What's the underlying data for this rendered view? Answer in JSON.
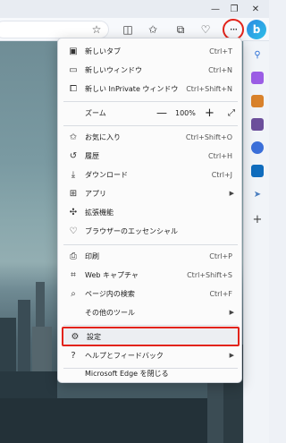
{
  "toolbar": {
    "more_label": "···",
    "copilot_label": "b"
  },
  "menu": {
    "new_tab": {
      "label": "新しいタブ",
      "shortcut": "Ctrl+T"
    },
    "new_window": {
      "label": "新しいウィンドウ",
      "shortcut": "Ctrl+N"
    },
    "new_inprivate": {
      "label": "新しい InPrivate ウィンドウ",
      "shortcut": "Ctrl+Shift+N"
    },
    "zoom": {
      "label": "ズーム",
      "minus": "—",
      "value": "100%",
      "plus": "+"
    },
    "favorites": {
      "label": "お気に入り",
      "shortcut": "Ctrl+Shift+O"
    },
    "history": {
      "label": "履歴",
      "shortcut": "Ctrl+H"
    },
    "downloads": {
      "label": "ダウンロード",
      "shortcut": "Ctrl+J"
    },
    "apps": {
      "label": "アプリ"
    },
    "extensions": {
      "label": "拡張機能"
    },
    "browser_essentials": {
      "label": "ブラウザーのエッセンシャル"
    },
    "print": {
      "label": "印刷",
      "shortcut": "Ctrl+P"
    },
    "web_capture": {
      "label": "Web キャプチャ",
      "shortcut": "Ctrl+Shift+S"
    },
    "find_on_page": {
      "label": "ページ内の検索",
      "shortcut": "Ctrl+F"
    },
    "more_tools": {
      "label": "その他のツール"
    },
    "settings": {
      "label": "設定"
    },
    "help_feedback": {
      "label": "ヘルプとフィードバック"
    },
    "close_edge": {
      "label": "Microsoft Edge を閉じる"
    }
  }
}
